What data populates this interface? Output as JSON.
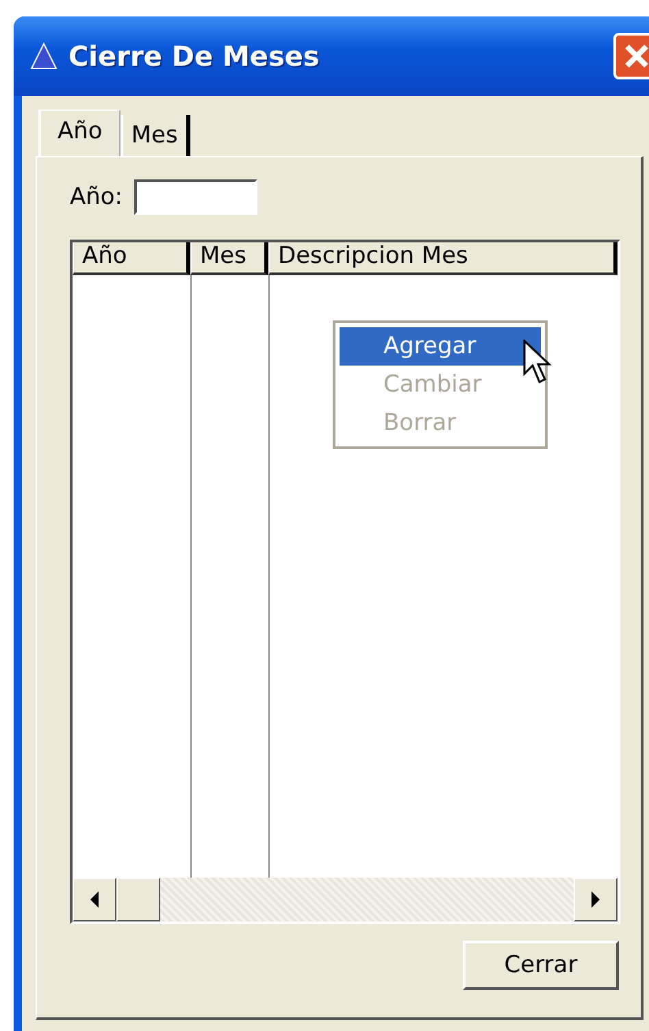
{
  "window": {
    "title": "Cierre De Meses"
  },
  "tabs": [
    {
      "label": "Año",
      "selected": true
    },
    {
      "label": "Mes",
      "selected": false
    }
  ],
  "year_field": {
    "label": "Año:"
  },
  "table": {
    "columns": [
      "Año",
      "Mes",
      "Descripcion Mes"
    ]
  },
  "context_menu": [
    {
      "label": "Agregar",
      "selected": true,
      "disabled": false
    },
    {
      "label": "Cambiar",
      "selected": false,
      "disabled": true
    },
    {
      "label": "Borrar",
      "selected": false,
      "disabled": true
    }
  ],
  "buttons": [
    "Cerrar"
  ]
}
